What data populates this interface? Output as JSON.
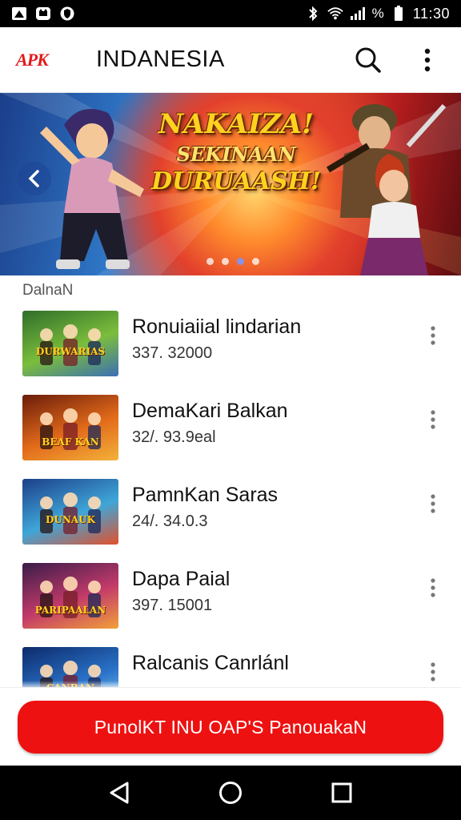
{
  "status_bar": {
    "time": "11:30",
    "battery_percent_label": "%",
    "icons": [
      "app-notification-icon",
      "cat-icon",
      "shield-icon",
      "bluetooth-icon",
      "wifi-icon",
      "signal-icon",
      "battery-icon"
    ]
  },
  "app_bar": {
    "logo_text": "APK",
    "title": "INDANESIA",
    "icons": [
      "search-icon",
      "more-vert-icon"
    ]
  },
  "banner": {
    "title_line1": "NAKAIZA!",
    "title_line2": "SEKINAAN",
    "title_line3": "DURUAASH!",
    "page_count": 4,
    "active_page": 3
  },
  "section": {
    "label": "DalnaN"
  },
  "apps": [
    {
      "title": "Ronuiaiial lindarian",
      "subtitle": "337. 32000",
      "thumb_text": "DURWARIAS",
      "colors": [
        "#2f6e2a",
        "#7bbd3c",
        "#3b6fb4"
      ]
    },
    {
      "title": "DemaKari Balkan",
      "subtitle": "32/. 93.9eal",
      "thumb_text": "BEAF KAN",
      "colors": [
        "#6a1c0a",
        "#e26a1a",
        "#f3b23a"
      ]
    },
    {
      "title": "PamnKan Saras",
      "subtitle": "24/. 34.0.3",
      "thumb_text": "DUNAUK",
      "colors": [
        "#1c3f8a",
        "#3fa6d8",
        "#e2502c"
      ]
    },
    {
      "title": "Dapa Paial",
      "subtitle": "397. 15001",
      "thumb_text": "PARIPAALAN",
      "colors": [
        "#3a1c4a",
        "#c23a6a",
        "#f2a03a"
      ]
    },
    {
      "title": "Ralcanis Canrlánl",
      "subtitle": "",
      "thumb_text": "CANBAN",
      "colors": [
        "#0c2a6a",
        "#2a72c8",
        "#7fd0f5"
      ]
    }
  ],
  "cta": {
    "label": "PunolKT INU OAP'S PanouakaN"
  },
  "nav_bar": {
    "icons": [
      "back-triangle-icon",
      "home-circle-icon",
      "recents-square-icon"
    ]
  },
  "colors": {
    "accent": "#ee1111",
    "status_bar_bg": "#000000",
    "active_dot": "#8a8fe8"
  }
}
